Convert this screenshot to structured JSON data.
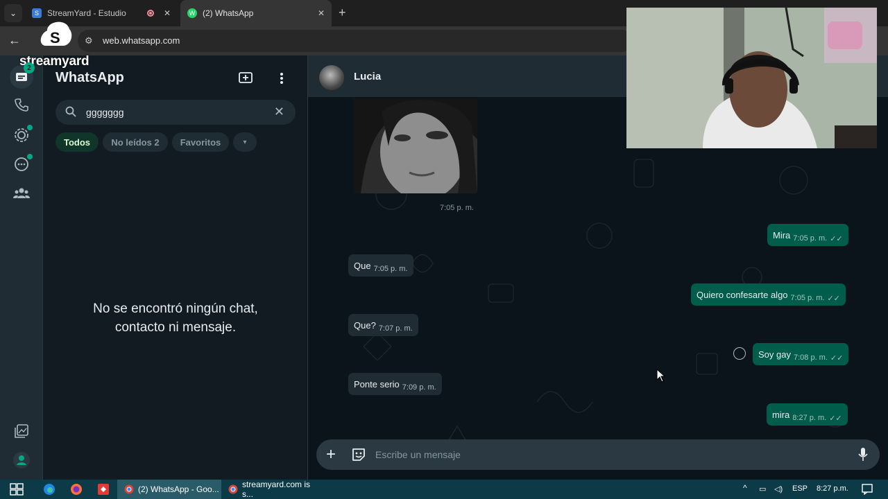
{
  "browser": {
    "tabs": [
      {
        "title": "StreamYard - Estudio",
        "favicon": "S"
      },
      {
        "title": "(2) WhatsApp",
        "favicon": "W"
      }
    ],
    "url": "web.whatsapp.com",
    "overlay_logo_text": "streamyard"
  },
  "rail": {
    "badge": "2"
  },
  "sidebar": {
    "title": "WhatsApp",
    "search_value": "ggggggg",
    "filters": [
      "Todos",
      "No leídos 2",
      "Favoritos"
    ],
    "empty_line1": "No se encontró ningún chat,",
    "empty_line2": "contacto ni mensaje."
  },
  "conversation": {
    "contact_name": "Lucia",
    "image_time": "7:05 p. m.",
    "messages": [
      {
        "dir": "out",
        "text": "Mira",
        "time": "7:05 p. m."
      },
      {
        "dir": "in",
        "text": "Que",
        "time": "7:05 p. m."
      },
      {
        "dir": "out",
        "text": "Quiero confesarte algo",
        "time": "7:05 p. m."
      },
      {
        "dir": "in",
        "text": "Que?",
        "time": "7:07 p. m."
      },
      {
        "dir": "out",
        "text": "Soy gay",
        "time": "7:08 p. m."
      },
      {
        "dir": "in",
        "text": "Ponte serio",
        "time": "7:09 p. m."
      },
      {
        "dir": "out",
        "text": "mira",
        "time": "8:27 p. m."
      }
    ],
    "composer_placeholder": "Escribe un mensaje",
    "check_glyph": "✓✓"
  },
  "taskbar": {
    "items": [
      "(2) WhatsApp - Goo...",
      "streamyard.com is s..."
    ],
    "lang": "ESP",
    "clock": "8:27 p.m."
  },
  "colors": {
    "accent": "#00a884",
    "outgoing_bubble": "#005c4b",
    "incoming_bubble": "#202c33",
    "background": "#0b141a"
  }
}
